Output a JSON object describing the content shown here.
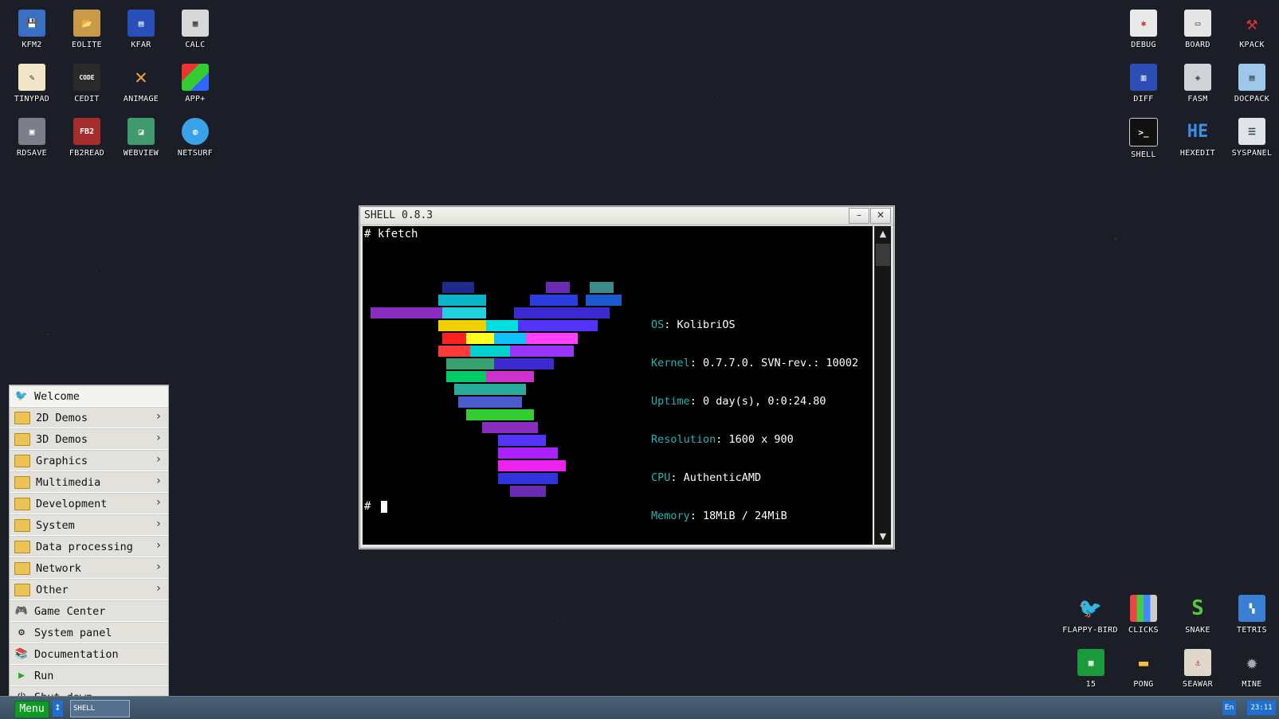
{
  "desktop": {
    "left_icons": [
      {
        "label": "KFM2",
        "icon": "floppy-disk-icon"
      },
      {
        "label": "EOLITE",
        "icon": "folder-icon"
      },
      {
        "label": "KFAR",
        "icon": "file-manager-icon"
      },
      {
        "label": "CALC",
        "icon": "calculator-icon"
      },
      {
        "label": "TINYPAD",
        "icon": "notepad-icon"
      },
      {
        "label": "CEDIT",
        "icon": "code-editor-icon"
      },
      {
        "label": "ANIMAGE",
        "icon": "paint-tools-icon"
      },
      {
        "label": "APP+",
        "icon": "app-cube-icon"
      },
      {
        "label": "RDSAVE",
        "icon": "ramdisk-save-icon"
      },
      {
        "label": "FB2READ",
        "icon": "book-reader-icon"
      },
      {
        "label": "WEBVIEW",
        "icon": "web-view-icon"
      },
      {
        "label": "NETSURF",
        "icon": "globe-icon"
      }
    ],
    "right_icons": [
      {
        "label": "DEBUG",
        "icon": "bug-icon"
      },
      {
        "label": "BOARD",
        "icon": "board-window-icon"
      },
      {
        "label": "KPACK",
        "icon": "hammer-icon"
      },
      {
        "label": "DIFF",
        "icon": "diff-icon"
      },
      {
        "label": "FASM",
        "icon": "assembler-icon"
      },
      {
        "label": "DOCPACK",
        "icon": "cabinet-icon"
      },
      {
        "label": "SHELL",
        "icon": "terminal-icon"
      },
      {
        "label": "HEXEDIT",
        "icon": "hex-editor-icon"
      },
      {
        "label": "SYSPANEL",
        "icon": "sliders-icon"
      }
    ],
    "game_icons": [
      {
        "label": "FLAPPY-BIRD",
        "icon": "bird-icon"
      },
      {
        "label": "CLICKS",
        "icon": "blocks-icon"
      },
      {
        "label": "SNAKE",
        "icon": "snake-icon"
      },
      {
        "label": "TETRIS",
        "icon": "tetris-icon"
      },
      {
        "label": "15",
        "icon": "fifteen-puzzle-icon"
      },
      {
        "label": "PONG",
        "icon": "pong-icon"
      },
      {
        "label": "SEAWAR",
        "icon": "battleship-icon"
      },
      {
        "label": "MINE",
        "icon": "mine-icon"
      }
    ]
  },
  "window": {
    "title": "SHELL 0.8.3",
    "minimize": "–",
    "close": "✕",
    "terminal": {
      "command_line": "# kfetch",
      "prompt": "#",
      "info": [
        {
          "key": "OS",
          "value": ": KolibriOS"
        },
        {
          "key": "Kernel",
          "value": ": 0.7.7.0. SVN-rev.: 10002"
        },
        {
          "key": "Uptime",
          "value": ": 0 day(s), 0:0:24.80"
        },
        {
          "key": "Resolution",
          "value": ": 1600 x 900"
        },
        {
          "key": "CPU",
          "value": ": AuthenticAMD"
        },
        {
          "key": "Memory",
          "value": ": 18MiB / 24MiB"
        }
      ]
    }
  },
  "start_menu": {
    "items": [
      {
        "label": "Welcome",
        "icon": "bird-icon",
        "submenu": false
      },
      {
        "label": "2D Demos",
        "icon": "folder-icon",
        "submenu": true
      },
      {
        "label": "3D Demos",
        "icon": "folder-icon",
        "submenu": true
      },
      {
        "label": "Graphics",
        "icon": "folder-icon",
        "submenu": true
      },
      {
        "label": "Multimedia",
        "icon": "folder-icon",
        "submenu": true
      },
      {
        "label": "Development",
        "icon": "folder-icon",
        "submenu": true
      },
      {
        "label": "System",
        "icon": "folder-icon",
        "submenu": true
      },
      {
        "label": "Data processing",
        "icon": "folder-icon",
        "submenu": true
      },
      {
        "label": "Network",
        "icon": "folder-icon",
        "submenu": true
      },
      {
        "label": "Other",
        "icon": "folder-icon",
        "submenu": true
      },
      {
        "label": "Game Center",
        "icon": "gamepad-icon",
        "submenu": false
      },
      {
        "label": "System panel",
        "icon": "gears-icon",
        "submenu": false
      },
      {
        "label": "Documentation",
        "icon": "books-icon",
        "submenu": false
      },
      {
        "label": "Run",
        "icon": "play-icon",
        "submenu": false
      },
      {
        "label": "Shut down",
        "icon": "power-icon",
        "submenu": false
      }
    ]
  },
  "taskbar": {
    "menu_label": "Menu",
    "arrows": "↕",
    "task_label": "SHELL",
    "lang": "En",
    "clock": "23:11"
  }
}
